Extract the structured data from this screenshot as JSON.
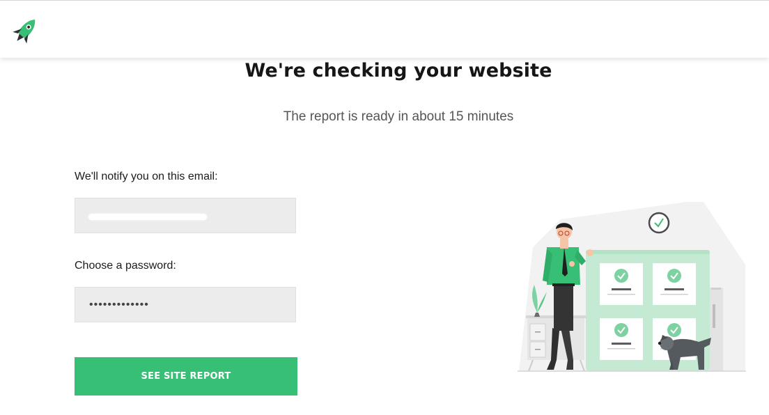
{
  "header": {
    "logo_icon": "rocket-icon",
    "brand_color": "#36bf75"
  },
  "main": {
    "title": "We're checking your website",
    "subtitle": "The report is ready in about 15 minutes"
  },
  "form": {
    "email_label": "We'll notify you on this email:",
    "email_value": "",
    "password_label": "Choose a password:",
    "password_value": "•••••••••••••",
    "submit_label": "SEE SITE REPORT"
  },
  "illustration": {
    "icons": [
      "clock-icon",
      "check-icon",
      "plant-icon",
      "dog-icon",
      "person-figure"
    ]
  }
}
